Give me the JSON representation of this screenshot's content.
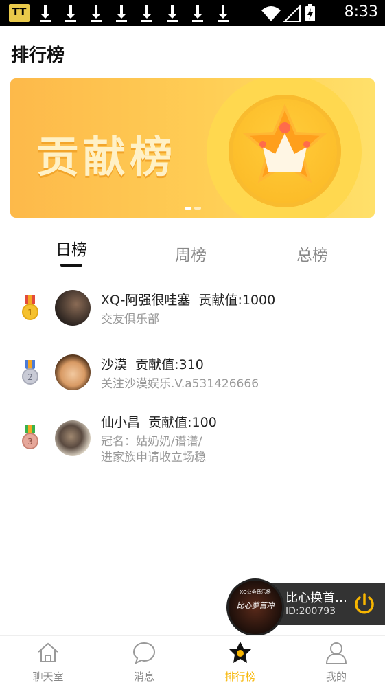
{
  "status_bar": {
    "time": "8:33",
    "app_icon_text": "TT"
  },
  "page": {
    "title": "排行榜"
  },
  "banner": {
    "text": "贡献榜",
    "colors": {
      "start": "#fdb94a",
      "end": "#ffe06a"
    },
    "slide_count": 2,
    "active_slide": 1
  },
  "tabs": [
    {
      "label": "日榜",
      "active": true
    },
    {
      "label": "周榜",
      "active": false
    },
    {
      "label": "总榜",
      "active": false
    }
  ],
  "ranking": [
    {
      "rank": 1,
      "medal": "gold-medal-icon",
      "name": "XQ-阿强很哇塞",
      "contribution": "贡献值:1000",
      "desc_lines": [
        "交友俱乐部"
      ]
    },
    {
      "rank": 2,
      "medal": "silver-medal-icon",
      "name": "沙漠",
      "contribution": "贡献值:310",
      "desc_lines": [
        "关注沙漠娱乐.V.a531426666"
      ]
    },
    {
      "rank": 3,
      "medal": "bronze-medal-icon",
      "name": "仙小昌",
      "contribution": "贡献值:100",
      "desc_lines": [
        "冠名：姑奶奶/谱谱/",
        "进家族申请收立场稳"
      ]
    }
  ],
  "player": {
    "title": "比心换首…",
    "subtitle": "ID:200793",
    "disc_text": "比心夢首冲",
    "disc_top": "XQ公会音乐杨"
  },
  "bottom_nav": [
    {
      "label": "聊天室",
      "icon": "home-icon",
      "active": false
    },
    {
      "label": "消息",
      "icon": "message-icon",
      "active": false
    },
    {
      "label": "排行榜",
      "icon": "ranking-icon",
      "active": true
    },
    {
      "label": "我的",
      "icon": "user-icon",
      "active": false
    }
  ],
  "colors": {
    "accent": "#f7b500",
    "player_bg": "#333333"
  }
}
